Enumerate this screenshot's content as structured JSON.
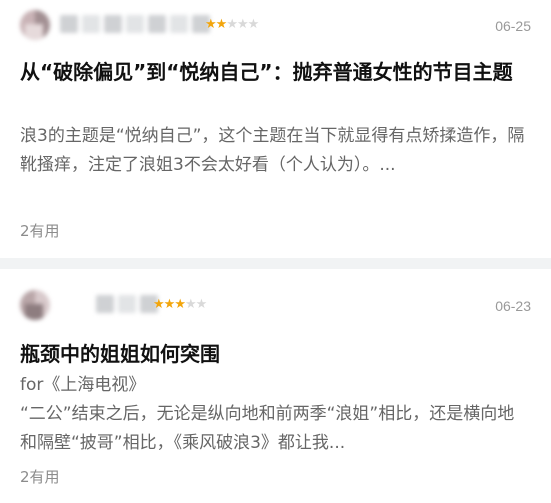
{
  "reviews": [
    {
      "date": "06-25",
      "title": "从“破除偏见”到“悦纳自己”：抛弃普通女性的节目主题",
      "body": "浪3的主题是“悦纳自己”，这个主题在当下就显得有点矫揉造作，隔靴搔痒，注定了浪姐3不会太好看（个人认为）。...",
      "useful": "2有用",
      "rating": 2,
      "rating_max": 5
    },
    {
      "date": "06-23",
      "title": "瓶颈中的姐姐如何突围",
      "source": "for《上海电视》",
      "body": "“二公”结束之后，无论是纵向地和前两季“浪姐”相比，还是横向地和隔壁“披哥”相比，《乘风破浪3》都让我...",
      "useful": "2有用",
      "rating": 3,
      "rating_max": 5
    }
  ],
  "colors": {
    "star_on": "#f2a50c",
    "star_off": "#d9d9d9",
    "divider": "#f1f3f4"
  }
}
